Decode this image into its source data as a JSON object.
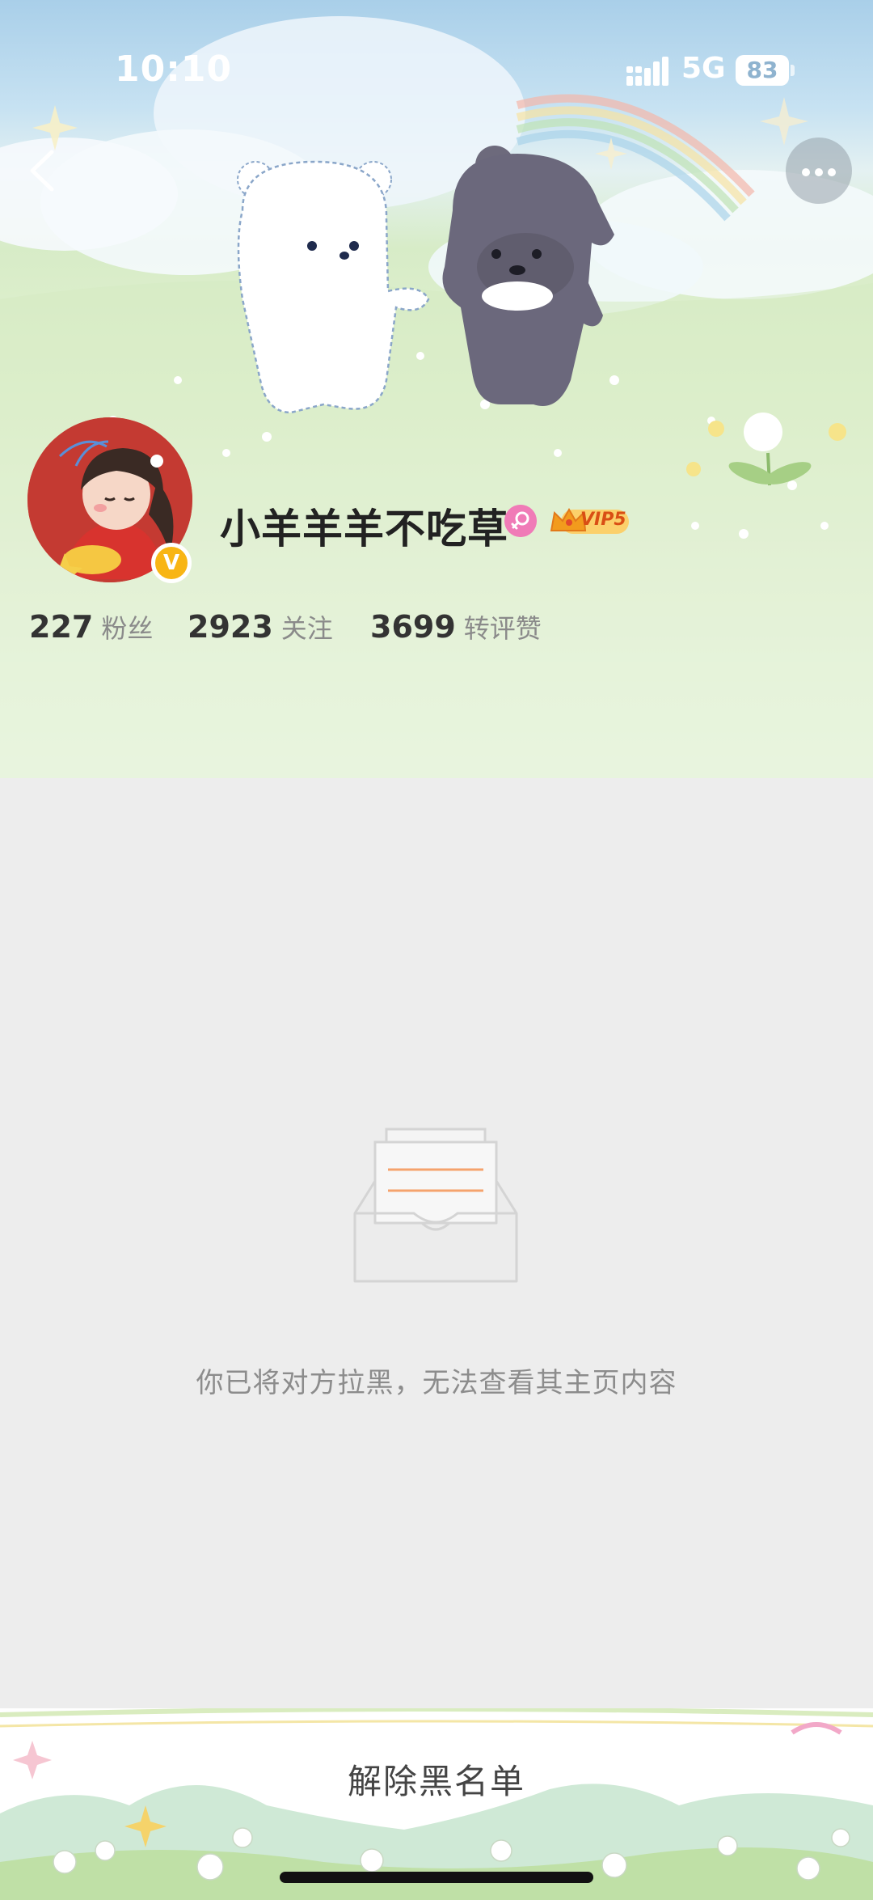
{
  "status_bar": {
    "time": "10:10",
    "network": "5G",
    "battery": "83"
  },
  "header": {
    "back_icon": "chevron-left-icon",
    "more_icon": "ellipsis-icon"
  },
  "profile": {
    "username": "小羊羊羊不吃草",
    "gender": "female",
    "vip_label": "VIP5",
    "verified_mark": "V",
    "stats": [
      {
        "value": "227",
        "label": "粉丝"
      },
      {
        "value": "2923",
        "label": "关注"
      },
      {
        "value": "3699",
        "label": "转评赞"
      }
    ]
  },
  "content": {
    "empty_icon": "empty-box-icon",
    "message": "你已将对方拉黑，无法查看其主页内容"
  },
  "action": {
    "unblock_label": "解除黑名单"
  },
  "colors": {
    "accent_orange": "#f5a36d",
    "vip_gold": "#f8b514",
    "gender_pink": "#f07bb7",
    "avatar_red": "#c83a32"
  }
}
